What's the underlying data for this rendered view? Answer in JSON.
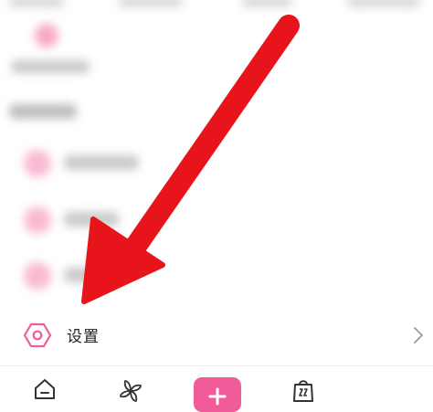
{
  "settings": {
    "label": "设置"
  },
  "icons": {
    "settings": "hexagon-gear-icon",
    "chevron": "chevron-right-icon",
    "home": "home-icon",
    "discover": "pinwheel-icon",
    "add": "plus-icon",
    "shop": "shopping-bag-icon"
  },
  "colors": {
    "accent": "#f15b9a",
    "arrow": "#e8141b",
    "text": "#222222",
    "icon": "#333333"
  }
}
